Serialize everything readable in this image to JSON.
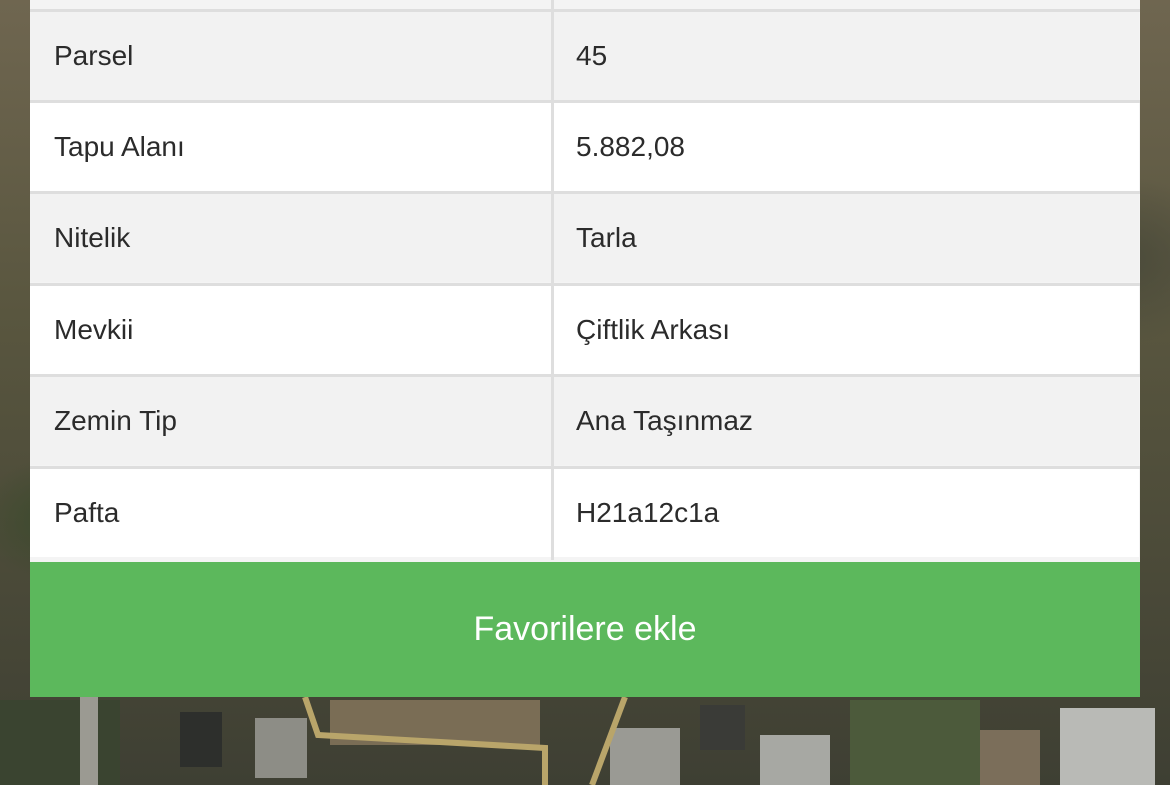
{
  "property_table": {
    "rows": [
      {
        "label": "Parsel",
        "value": "45"
      },
      {
        "label": "Tapu Alanı",
        "value": "5.882,08"
      },
      {
        "label": "Nitelik",
        "value": "Tarla"
      },
      {
        "label": "Mevkii",
        "value": "Çiftlik Arkası"
      },
      {
        "label": "Zemin Tip",
        "value": "Ana Taşınmaz"
      },
      {
        "label": "Pafta",
        "value": "H21a12c1a"
      }
    ]
  },
  "actions": {
    "add_favorite_label": "Favorilere ekle"
  },
  "colors": {
    "button_green": "#5cb85c",
    "parcel_outline": "#b9a56a"
  }
}
